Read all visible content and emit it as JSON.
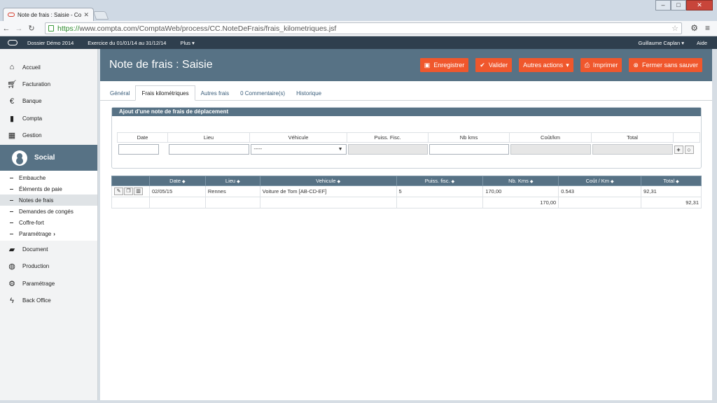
{
  "browser": {
    "tab_title": "Note de frais : Saisie - Co",
    "url_scheme": "https://",
    "url_rest": "www.compta.com/ComptaWeb/process/CC.NoteDeFrais/frais_kilometriques.jsf"
  },
  "appbar": {
    "dossier": "Dossier Démo 2014",
    "exercice": "Exercice du 01/01/14 au 31/12/14",
    "plus": "Plus",
    "user": "Guillaume Caplan",
    "help": "Aide"
  },
  "sidebar": {
    "top_items": [
      {
        "label": "Accueil",
        "icon": "home-icon"
      },
      {
        "label": "Facturation",
        "icon": "cart-icon"
      },
      {
        "label": "Banque",
        "icon": "euro-icon"
      },
      {
        "label": "Compta",
        "icon": "book-icon"
      },
      {
        "label": "Gestion",
        "icon": "grid-icon"
      }
    ],
    "active_section": "Social",
    "sub_items": [
      "Embauche",
      "Éléments de paie",
      "Notes de frais",
      "Demandes de congés",
      "Coffre-fort",
      "Paramétrage"
    ],
    "bottom_items": [
      {
        "label": "Document",
        "icon": "folder-icon"
      },
      {
        "label": "Production",
        "icon": "globe-icon"
      },
      {
        "label": "Paramétrage",
        "icon": "gear-icon"
      },
      {
        "label": "Back Office",
        "icon": "bolt-icon"
      }
    ]
  },
  "header": {
    "title": "Note de frais : Saisie",
    "buttons": {
      "save": "Enregistrer",
      "validate": "Valider",
      "other": "Autres actions",
      "print": "Imprimer",
      "close": "Fermer sans sauver"
    }
  },
  "tabs": [
    "Général",
    "Frais kilométriques",
    "Autres frais",
    "0 Commentaire(s)",
    "Historique"
  ],
  "form": {
    "title": "Ajout d'une note de frais de déplacement",
    "headers": [
      "Date",
      "Lieu",
      "Véhicule",
      "Puiss. Fisc.",
      "Nb kms",
      "Coût/km",
      "Total"
    ],
    "vehicle_placeholder": "-----"
  },
  "grid": {
    "headers": [
      "Date",
      "Lieu",
      "Vehicule",
      "Puiss. fisc.",
      "Nb. Kms",
      "Coût / Km",
      "Total"
    ],
    "row": {
      "date": "02/05/15",
      "lieu": "Rennes",
      "vehicule": "Voiture de Tom [AB-CD-EF]",
      "puissance": "5",
      "kms": "170,00",
      "cout": "0.543",
      "total": "92,31"
    },
    "totals": {
      "kms": "170,00",
      "total": "92,31"
    }
  },
  "colors": {
    "accent": "#577285",
    "button": "#f0572c",
    "appbar": "#2f3f4e"
  }
}
